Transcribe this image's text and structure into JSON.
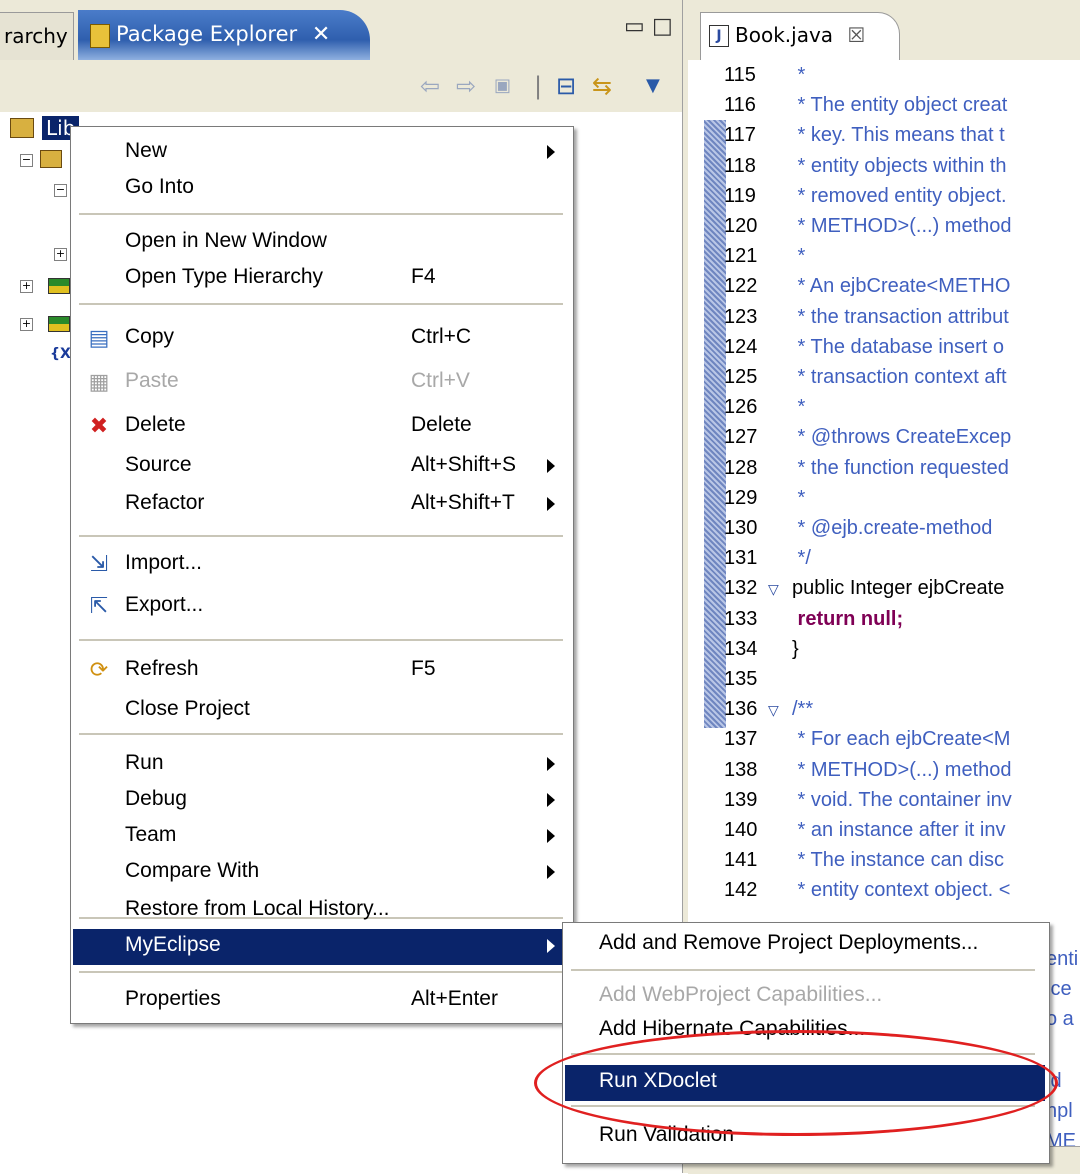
{
  "left": {
    "tab_hierarchy": "rarchy",
    "tab_package_explorer": "Package Explorer",
    "tab_close": "✕",
    "minimize": "▭",
    "maximize": "□",
    "project_label": "Lib",
    "tree_xml_label": "{X}"
  },
  "editor": {
    "tab_title": "Book.java",
    "tab_close": "☒",
    "lines": [
      {
        "n": "115",
        "fold": "",
        "text": "  *",
        "cls": "code"
      },
      {
        "n": "116",
        "fold": "",
        "text": "  * The entity object creat",
        "cls": "code"
      },
      {
        "n": "117",
        "fold": "",
        "text": "  * key. This means that t",
        "cls": "code"
      },
      {
        "n": "118",
        "fold": "",
        "text": "  * entity objects within th",
        "cls": "code"
      },
      {
        "n": "119",
        "fold": "",
        "text": "  * removed entity object.",
        "cls": "code"
      },
      {
        "n": "120",
        "fold": "",
        "text": "  * METHOD>(...) method",
        "cls": "code"
      },
      {
        "n": "121",
        "fold": "",
        "text": "  *",
        "cls": "code"
      },
      {
        "n": "122",
        "fold": "",
        "text": "  * An ejbCreate<METHO",
        "cls": "code"
      },
      {
        "n": "123",
        "fold": "",
        "text": "  * the transaction attribut",
        "cls": "code"
      },
      {
        "n": "124",
        "fold": "",
        "text": "  * The database insert o",
        "cls": "code"
      },
      {
        "n": "125",
        "fold": "",
        "text": "  * transaction context aft",
        "cls": "code"
      },
      {
        "n": "126",
        "fold": "",
        "text": "  *",
        "cls": "code"
      },
      {
        "n": "127",
        "fold": "",
        "text": "  * @throws CreateExcep",
        "cls": "code"
      },
      {
        "n": "128",
        "fold": "",
        "text": "  * the function requested",
        "cls": "code"
      },
      {
        "n": "129",
        "fold": "",
        "text": "  *",
        "cls": "code"
      },
      {
        "n": "130",
        "fold": "",
        "text": "  * @ejb.create-method",
        "cls": "code"
      },
      {
        "n": "131",
        "fold": "",
        "text": "  */",
        "cls": "code"
      },
      {
        "n": "132",
        "fold": "▽",
        "text": "public Integer ejbCreate",
        "cls": "code plain"
      },
      {
        "n": "133",
        "fold": "",
        "text": "   return null;",
        "cls": "code kw"
      },
      {
        "n": "134",
        "fold": "",
        "text": "}",
        "cls": "code plain"
      },
      {
        "n": "135",
        "fold": "",
        "text": "",
        "cls": "code plain"
      },
      {
        "n": "136",
        "fold": "▽",
        "text": "/**",
        "cls": "code"
      },
      {
        "n": "137",
        "fold": "",
        "text": "  * For each ejbCreate<M",
        "cls": "code"
      },
      {
        "n": "138",
        "fold": "",
        "text": "  * METHOD>(...) method",
        "cls": "code"
      },
      {
        "n": "139",
        "fold": "",
        "text": "  * void. The container inv",
        "cls": "code"
      },
      {
        "n": "140",
        "fold": "",
        "text": "  * an instance after it inv",
        "cls": "code"
      },
      {
        "n": "141",
        "fold": "",
        "text": "  * The instance can disc",
        "cls": "code"
      },
      {
        "n": "142",
        "fold": "",
        "text": "  * entity context object. <",
        "cls": "code"
      }
    ],
    "peek_right": [
      "enti",
      "ice",
      "o a",
      "id",
      "npl",
      "ME"
    ]
  },
  "menu": {
    "items": [
      {
        "label": "New",
        "accel": "",
        "submenu": true,
        "icon": ""
      },
      {
        "label": "Go Into",
        "accel": "",
        "submenu": false,
        "icon": ""
      },
      {
        "label": "Open in New Window",
        "accel": "",
        "submenu": false,
        "icon": ""
      },
      {
        "label": "Open Type Hierarchy",
        "accel": "F4",
        "submenu": false,
        "icon": ""
      },
      {
        "label": "Copy",
        "accel": "Ctrl+C",
        "submenu": false,
        "icon": "copy-icon"
      },
      {
        "label": "Paste",
        "accel": "Ctrl+V",
        "submenu": false,
        "icon": "paste-icon",
        "disabled": true
      },
      {
        "label": "Delete",
        "accel": "Delete",
        "submenu": false,
        "icon": "delete-icon"
      },
      {
        "label": "Source",
        "accel": "Alt+Shift+S",
        "submenu": true,
        "icon": ""
      },
      {
        "label": "Refactor",
        "accel": "Alt+Shift+T",
        "submenu": true,
        "icon": ""
      },
      {
        "label": "Import...",
        "accel": "",
        "submenu": false,
        "icon": "import-icon"
      },
      {
        "label": "Export...",
        "accel": "",
        "submenu": false,
        "icon": "export-icon"
      },
      {
        "label": "Refresh",
        "accel": "F5",
        "submenu": false,
        "icon": "refresh-icon"
      },
      {
        "label": "Close Project",
        "accel": "",
        "submenu": false,
        "icon": ""
      },
      {
        "label": "Run",
        "accel": "",
        "submenu": true,
        "icon": ""
      },
      {
        "label": "Debug",
        "accel": "",
        "submenu": true,
        "icon": ""
      },
      {
        "label": "Team",
        "accel": "",
        "submenu": true,
        "icon": ""
      },
      {
        "label": "Compare With",
        "accel": "",
        "submenu": true,
        "icon": ""
      },
      {
        "label": "Restore from Local History...",
        "accel": "",
        "submenu": false,
        "icon": ""
      },
      {
        "label": "MyEclipse",
        "accel": "",
        "submenu": true,
        "icon": "",
        "selected": true
      },
      {
        "label": "Properties",
        "accel": "Alt+Enter",
        "submenu": false,
        "icon": ""
      }
    ]
  },
  "submenu": {
    "items": [
      {
        "label": "Add and Remove Project Deployments...",
        "disabled": false
      },
      {
        "label": "Add WebProject Capabilities...",
        "disabled": true
      },
      {
        "label": "Add Hibernate Capabilities...",
        "disabled": false
      },
      {
        "label": "Run XDoclet",
        "disabled": false,
        "selected": true
      },
      {
        "label": "Run Validation",
        "disabled": false
      }
    ]
  },
  "colors": {
    "selection": "#0a246a",
    "highlight_ring": "#e02020",
    "javadoc": "#3f5fbf",
    "keyword": "#7f0055"
  }
}
